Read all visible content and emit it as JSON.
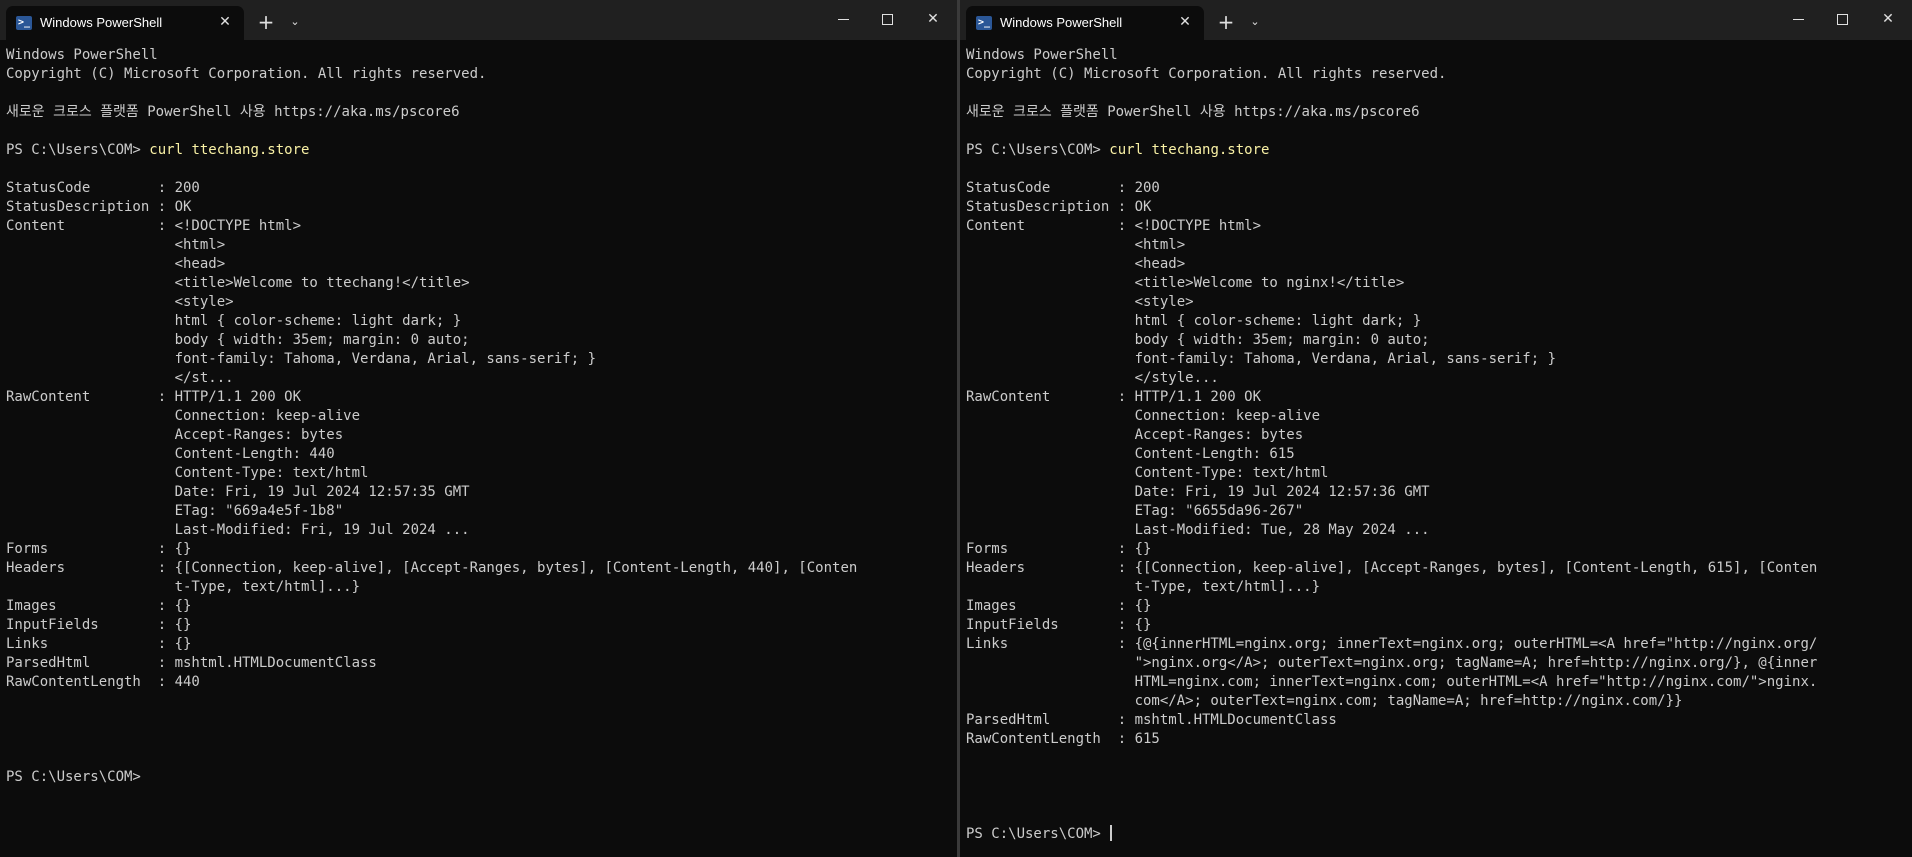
{
  "left": {
    "tab_title": "Windows PowerShell",
    "lines": [
      "Windows PowerShell",
      "Copyright (C) Microsoft Corporation. All rights reserved.",
      "",
      "새로운 크로스 플랫폼 PowerShell 사용 https://aka.ms/pscore6",
      "",
      "PS C:\\Users\\COM> ",
      "",
      "StatusCode        : 200",
      "StatusDescription : OK",
      "Content           : <!DOCTYPE html>",
      "                    <html>",
      "                    <head>",
      "                    <title>Welcome to ttechang!</title>",
      "                    <style>",
      "                    html { color-scheme: light dark; }",
      "                    body { width: 35em; margin: 0 auto;",
      "                    font-family: Tahoma, Verdana, Arial, sans-serif; }",
      "                    </st...",
      "RawContent        : HTTP/1.1 200 OK",
      "                    Connection: keep-alive",
      "                    Accept-Ranges: bytes",
      "                    Content-Length: 440",
      "                    Content-Type: text/html",
      "                    Date: Fri, 19 Jul 2024 12:57:35 GMT",
      "                    ETag: \"669a4e5f-1b8\"",
      "                    Last-Modified: Fri, 19 Jul 2024 ...",
      "Forms             : {}",
      "Headers           : {[Connection, keep-alive], [Accept-Ranges, bytes], [Content-Length, 440], [Conten",
      "                    t-Type, text/html]...}",
      "Images            : {}",
      "InputFields       : {}",
      "Links             : {}",
      "ParsedHtml        : mshtml.HTMLDocumentClass",
      "RawContentLength  : 440",
      "",
      "",
      "",
      "",
      "PS C:\\Users\\COM>"
    ],
    "command": "curl ttechang.store"
  },
  "right": {
    "tab_title": "Windows PowerShell",
    "lines": [
      "Windows PowerShell",
      "Copyright (C) Microsoft Corporation. All rights reserved.",
      "",
      "새로운 크로스 플랫폼 PowerShell 사용 https://aka.ms/pscore6",
      "",
      "PS C:\\Users\\COM> ",
      "",
      "StatusCode        : 200",
      "StatusDescription : OK",
      "Content           : <!DOCTYPE html>",
      "                    <html>",
      "                    <head>",
      "                    <title>Welcome to nginx!</title>",
      "                    <style>",
      "                    html { color-scheme: light dark; }",
      "                    body { width: 35em; margin: 0 auto;",
      "                    font-family: Tahoma, Verdana, Arial, sans-serif; }",
      "                    </style...",
      "RawContent        : HTTP/1.1 200 OK",
      "                    Connection: keep-alive",
      "                    Accept-Ranges: bytes",
      "                    Content-Length: 615",
      "                    Content-Type: text/html",
      "                    Date: Fri, 19 Jul 2024 12:57:36 GMT",
      "                    ETag: \"6655da96-267\"",
      "                    Last-Modified: Tue, 28 May 2024 ...",
      "Forms             : {}",
      "Headers           : {[Connection, keep-alive], [Accept-Ranges, bytes], [Content-Length, 615], [Conten",
      "                    t-Type, text/html]...}",
      "Images            : {}",
      "InputFields       : {}",
      "Links             : {@{innerHTML=nginx.org; innerText=nginx.org; outerHTML=<A href=\"http://nginx.org/",
      "                    \">nginx.org</A>; outerText=nginx.org; tagName=A; href=http://nginx.org/}, @{inner",
      "                    HTML=nginx.com; innerText=nginx.com; outerHTML=<A href=\"http://nginx.com/\">nginx.",
      "                    com</A>; outerText=nginx.com; tagName=A; href=http://nginx.com/}}",
      "ParsedHtml        : mshtml.HTMLDocumentClass",
      "RawContentLength  : 615",
      "",
      "",
      "",
      "",
      "PS C:\\Users\\COM> "
    ],
    "command": "curl ttechang.store"
  },
  "icons": {
    "tab_icon": "powershell-icon",
    "close": "close-icon",
    "add": "plus-icon",
    "dropdown": "chevron-down-icon"
  },
  "colors": {
    "background": "#0c0c0c",
    "titlebar": "#202020",
    "text": "#cccccc",
    "command": "#f9f1a5"
  }
}
